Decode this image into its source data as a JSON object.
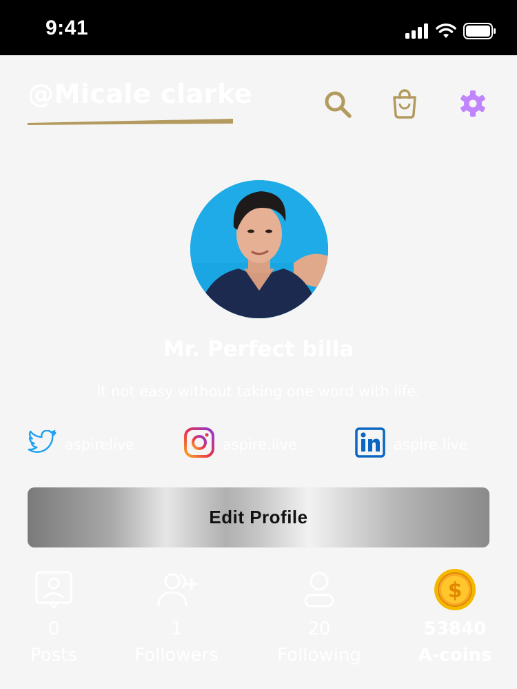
{
  "status_bar": {
    "time": "9:41"
  },
  "header": {
    "handle": "@Micale clarke"
  },
  "colors": {
    "gold": "#b39a5e",
    "settings_purple": "#c084fc",
    "twitter_blue": "#1da1f2",
    "linkedin_blue": "#0a66c2",
    "background": "#f5f5f5"
  },
  "icons": [
    "search-icon",
    "shopping-bag-icon",
    "gear-icon"
  ],
  "profile": {
    "display_name": "Mr. Perfect billa",
    "bio": "It not easy without taking one word with life."
  },
  "socials": [
    {
      "network": "twitter",
      "label": "aspirelive"
    },
    {
      "network": "instagram",
      "label": "aspire.live"
    },
    {
      "network": "linkedin",
      "label": "aspire.live"
    }
  ],
  "edit_button": {
    "label": "Edit Profile"
  },
  "stats": [
    {
      "value": "0",
      "label": "Posts"
    },
    {
      "value": "1",
      "label": "Followers"
    },
    {
      "value": "20",
      "label": "Following"
    },
    {
      "value": "53840",
      "label": "A-coins"
    }
  ]
}
